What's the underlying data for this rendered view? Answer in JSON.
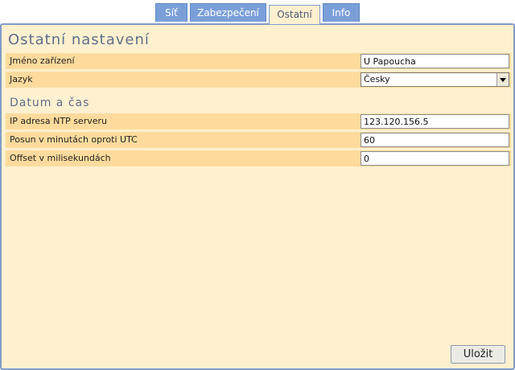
{
  "tabs": [
    {
      "label": "Síť",
      "active": false
    },
    {
      "label": "Zabezpečení",
      "active": false
    },
    {
      "label": "Ostatní",
      "active": true
    },
    {
      "label": "Info",
      "active": false
    }
  ],
  "page": {
    "title": "Ostatní nastavení"
  },
  "general": {
    "device_name": {
      "label": "Jméno zařízení",
      "value": "U Papoucha"
    },
    "language": {
      "label": "Jazyk",
      "value": "Česky"
    }
  },
  "datetime": {
    "title": "Datum a čas",
    "ntp": {
      "label": "IP adresa NTP serveru",
      "value": "123.120.156.5"
    },
    "utc_offset": {
      "label": "Posun v minutách oproti UTC",
      "value": "60"
    },
    "ms_offset": {
      "label": "Offset v milisekundách",
      "value": "0"
    }
  },
  "actions": {
    "save_label": "Uložit"
  },
  "colors": {
    "tab_bg": "#7a9fd8",
    "panel_bg": "#fff0d0",
    "row_bg": "#fedb9d",
    "heading": "#5e6f8c"
  }
}
